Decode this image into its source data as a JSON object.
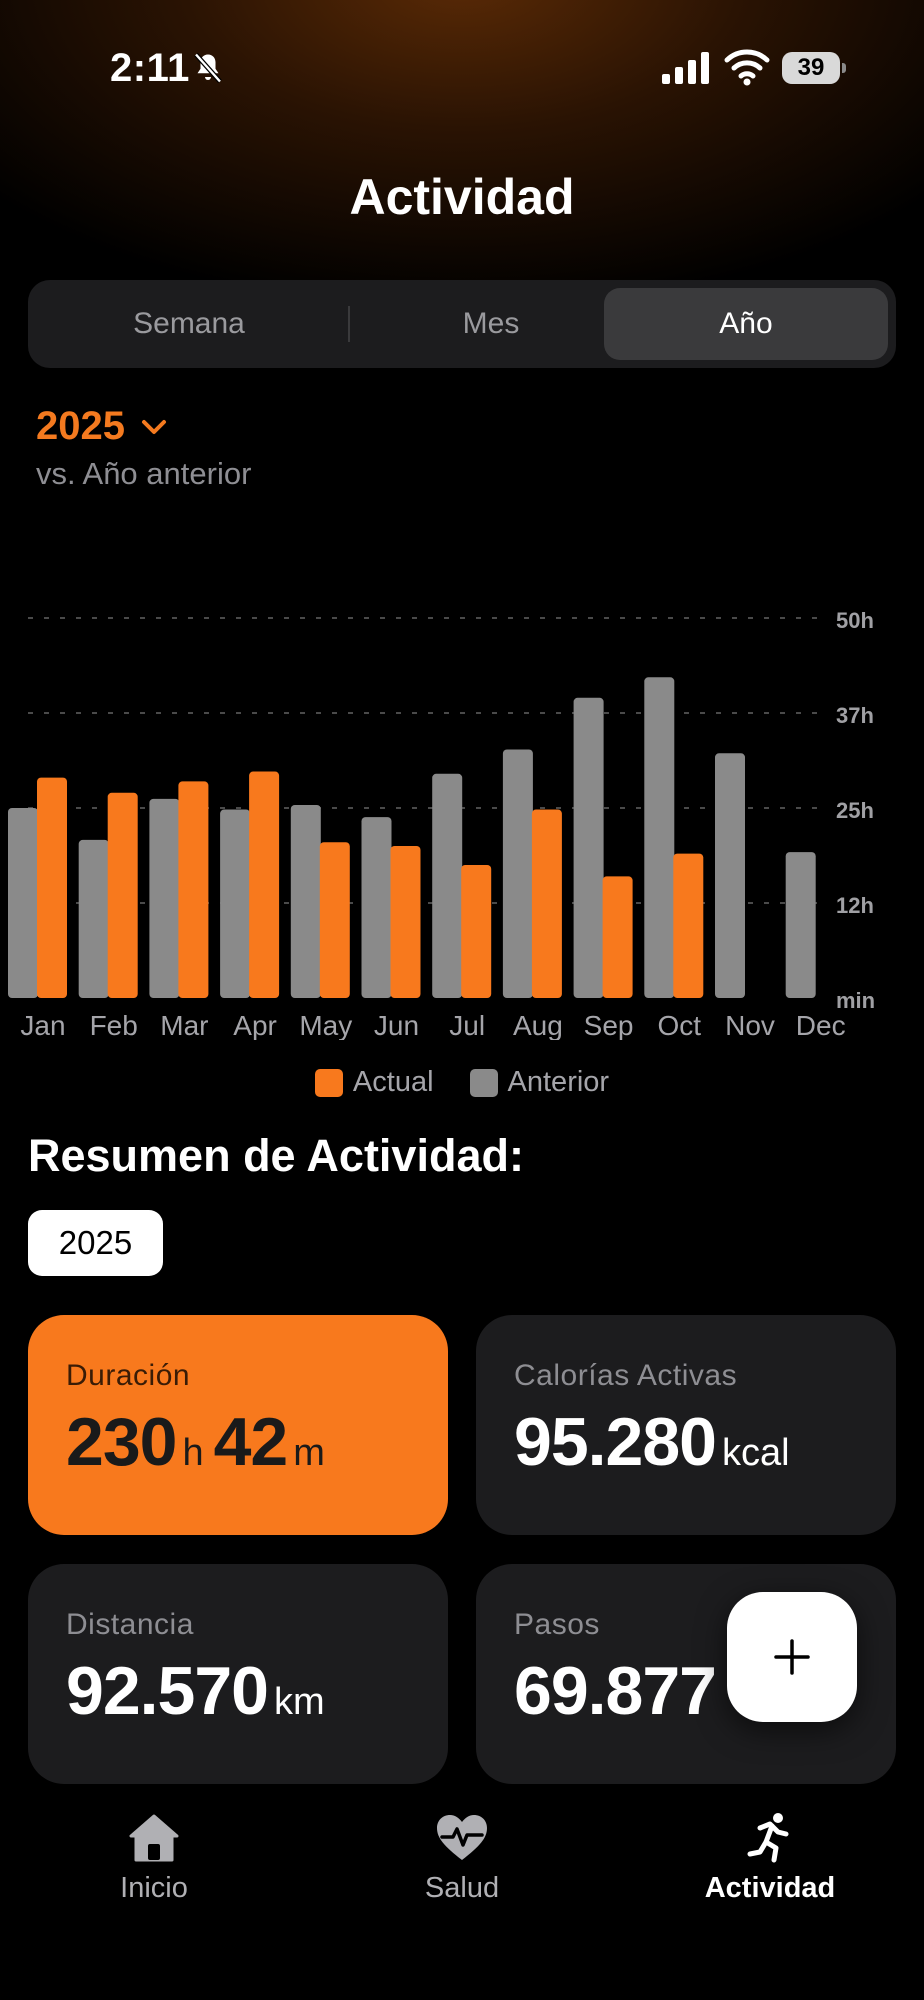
{
  "status_bar": {
    "time": "2:11",
    "battery": "39"
  },
  "header": {
    "title": "Actividad"
  },
  "segments": [
    {
      "label": "Semana",
      "active": false
    },
    {
      "label": "Mes",
      "active": false
    },
    {
      "label": "Año",
      "active": true
    }
  ],
  "period": {
    "year": "2025",
    "comparison": "vs. Año anterior"
  },
  "colors": {
    "accent": "#f8791d",
    "previous": "#8a8a8a",
    "card": "#1c1c1e"
  },
  "chart_data": {
    "type": "bar",
    "categories": [
      "Jan",
      "Feb",
      "Mar",
      "Apr",
      "May",
      "Jun",
      "Jul",
      "Aug",
      "Sep",
      "Oct",
      "Nov",
      "Dec"
    ],
    "series": [
      {
        "name": "Actual",
        "values": [
          29,
          27,
          28.5,
          29.8,
          20.5,
          20,
          17.5,
          24.8,
          16,
          19,
          null,
          null
        ]
      },
      {
        "name": "Anterior",
        "values": [
          25,
          20.8,
          26.2,
          24.8,
          25.4,
          23.8,
          29.5,
          32.7,
          39.5,
          42.2,
          32.2,
          19.2
        ]
      }
    ],
    "y_ticks": [
      "min",
      "12h",
      "25h",
      "37h",
      "50h"
    ],
    "ylim": [
      0,
      50
    ],
    "grid": true,
    "legend": "bottom"
  },
  "legend": {
    "current": "Actual",
    "previous": "Anterior"
  },
  "summary": {
    "title": "Resumen de Actividad:",
    "year_chip": "2025",
    "duration": {
      "label": "Duración",
      "hours": "230",
      "hours_unit": "h",
      "minutes": "42",
      "minutes_unit": "m"
    },
    "calories": {
      "label": "Calorías Activas",
      "value": "95.280",
      "unit": "kcal"
    },
    "distance": {
      "label": "Distancia",
      "value": "92.570",
      "unit": "km"
    },
    "steps": {
      "label": "Pasos",
      "value": "69.877"
    }
  },
  "fab": {
    "icon": "plus-icon"
  },
  "tabbar": [
    {
      "label": "Inicio",
      "icon": "home-icon",
      "active": false
    },
    {
      "label": "Salud",
      "icon": "heart-pulse-icon",
      "active": false
    },
    {
      "label": "Actividad",
      "icon": "running-icon",
      "active": true
    }
  ]
}
